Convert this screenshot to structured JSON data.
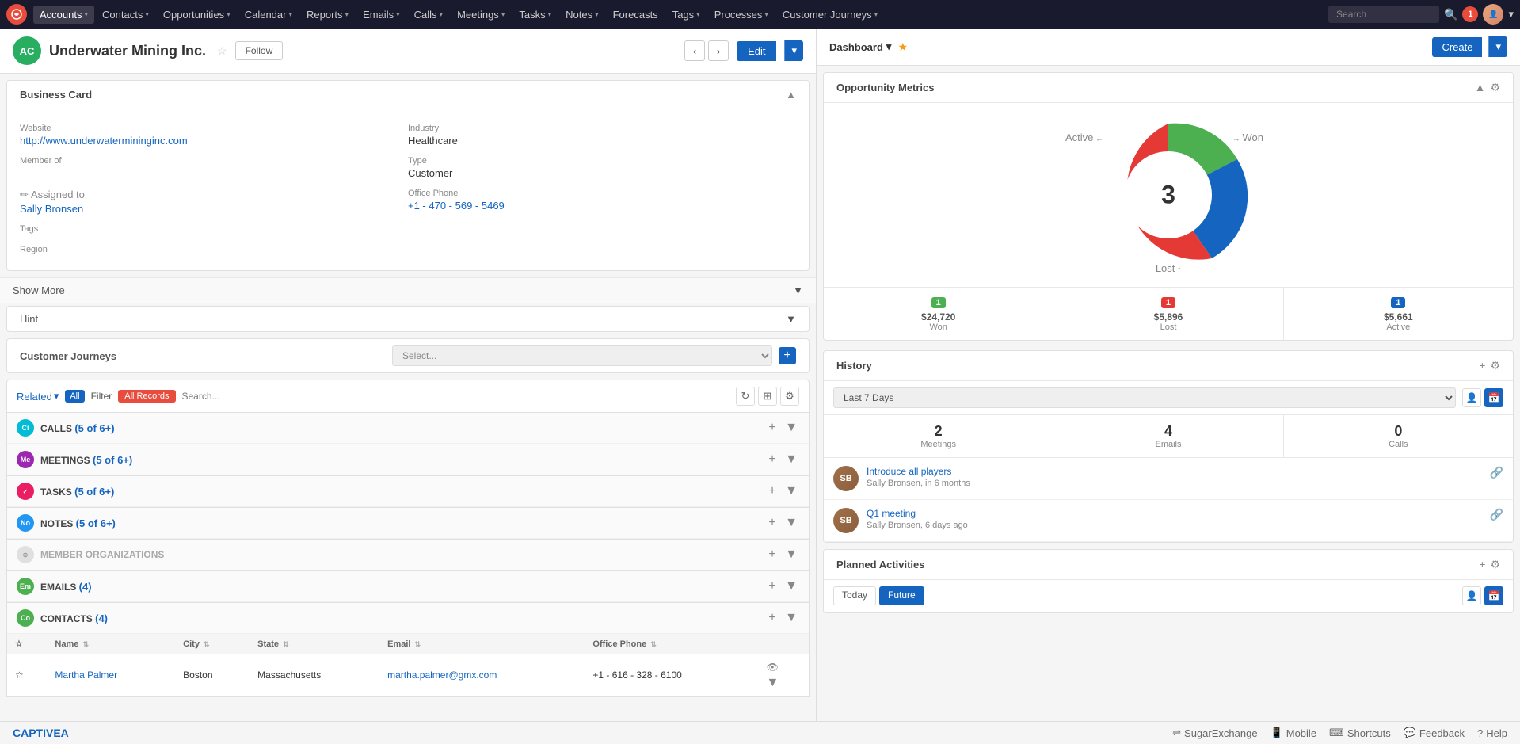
{
  "nav": {
    "logo": "SugarCRM",
    "items": [
      {
        "label": "Accounts",
        "active": true
      },
      {
        "label": "Contacts"
      },
      {
        "label": "Opportunities"
      },
      {
        "label": "Calendar"
      },
      {
        "label": "Reports"
      },
      {
        "label": "Emails"
      },
      {
        "label": "Calls"
      },
      {
        "label": "Meetings"
      },
      {
        "label": "Tasks"
      },
      {
        "label": "Notes"
      },
      {
        "label": "Forecasts"
      },
      {
        "label": "Tags"
      },
      {
        "label": "Processes"
      },
      {
        "label": "Customer Journeys"
      }
    ],
    "search_placeholder": "Search",
    "notification_count": "1"
  },
  "record": {
    "initials": "AC",
    "title": "Underwater Mining Inc.",
    "follow_label": "Follow",
    "edit_label": "Edit"
  },
  "business_card": {
    "section_title": "Business Card",
    "website_label": "Website",
    "website_value": "http://www.underwatermininginc.com",
    "industry_label": "Industry",
    "industry_value": "Healthcare",
    "member_of_label": "Member of",
    "member_of_value": "",
    "type_label": "Type",
    "type_value": "Customer",
    "assigned_to_label": "Assigned to",
    "assigned_to_value": "Sally Bronsen",
    "office_phone_label": "Office Phone",
    "office_phone_value": "+1 - 470 - 569 - 5469",
    "tags_label": "Tags",
    "tags_value": "",
    "region_label": "Region",
    "region_value": ""
  },
  "show_more_label": "Show More",
  "hint_label": "Hint",
  "customer_journeys_label": "Customer Journeys",
  "cj_select_placeholder": "Select...",
  "filter": {
    "related_label": "Related",
    "all_label": "All",
    "filter_label": "Filter",
    "all_records_label": "All Records",
    "search_placeholder": "Search..."
  },
  "subpanels": [
    {
      "id": "calls",
      "color": "sp-calls",
      "title": "CALLS",
      "count": "5 of 6+",
      "letter": "Ci"
    },
    {
      "id": "meetings",
      "color": "sp-meetings",
      "title": "MEETINGS",
      "count": "5 of 6+",
      "letter": "Me"
    },
    {
      "id": "tasks",
      "color": "sp-tasks",
      "title": "TASKS",
      "count": "5 of 6+",
      "letter": ""
    },
    {
      "id": "notes",
      "color": "sp-notes",
      "title": "NOTES",
      "count": "5 of 6+",
      "letter": "No"
    },
    {
      "id": "member-orgs",
      "color": "sp-member",
      "title": "MEMBER ORGANIZATIONS",
      "count": "",
      "letter": ""
    },
    {
      "id": "emails",
      "color": "sp-emails",
      "title": "EMAILS",
      "count": "4",
      "letter": "Em"
    },
    {
      "id": "contacts",
      "color": "sp-contacts",
      "title": "CONTACTS",
      "count": "4",
      "letter": "Co"
    }
  ],
  "contacts_table": {
    "columns": [
      "Name",
      "City",
      "State",
      "Email",
      "Office Phone"
    ],
    "rows": [
      {
        "name": "Martha Palmer",
        "city": "Boston",
        "state": "Massachusetts",
        "email": "martha.palmer@gmx.com",
        "phone": "+1 - 616 - 328 - 6100"
      }
    ]
  },
  "dashboard": {
    "title": "Dashboard",
    "create_label": "Create"
  },
  "opportunity_metrics": {
    "title": "Opportunity Metrics",
    "center_number": "3",
    "label_active": "Active",
    "label_won": "Won",
    "label_lost": "Lost",
    "stats": [
      {
        "badge": "1",
        "badge_class": "badge-green",
        "amount": "$24,720",
        "label": "Won"
      },
      {
        "badge": "1",
        "badge_class": "badge-red",
        "amount": "$5,896",
        "label": "Lost"
      },
      {
        "badge": "1",
        "badge_class": "badge-blue",
        "amount": "$5,661",
        "label": "Active"
      }
    ]
  },
  "history": {
    "title": "History",
    "period_label": "Last 7 Days",
    "stats": [
      {
        "num": "2",
        "label": "Meetings"
      },
      {
        "num": "4",
        "label": "Emails"
      },
      {
        "num": "0",
        "label": "Calls"
      }
    ],
    "items": [
      {
        "link": "Introduce all players",
        "meta": "Sally Bronsen, in 6 months",
        "avatar_initials": "SB"
      },
      {
        "link": "Q1 meeting",
        "meta": "Sally Bronsen, 6 days ago",
        "avatar_initials": "SB"
      }
    ]
  },
  "planned_activities": {
    "title": "Planned Activities",
    "tabs": [
      {
        "label": "Today"
      },
      {
        "label": "Future",
        "active": true
      }
    ]
  },
  "bottom_bar": {
    "logo": "CAPTIVEA",
    "items": [
      {
        "icon": "⇌",
        "label": "SugarExchange"
      },
      {
        "icon": "📱",
        "label": "Mobile"
      },
      {
        "icon": "⌨",
        "label": "Shortcuts"
      },
      {
        "icon": "💬",
        "label": "Feedback"
      },
      {
        "icon": "?",
        "label": "Help"
      }
    ]
  }
}
